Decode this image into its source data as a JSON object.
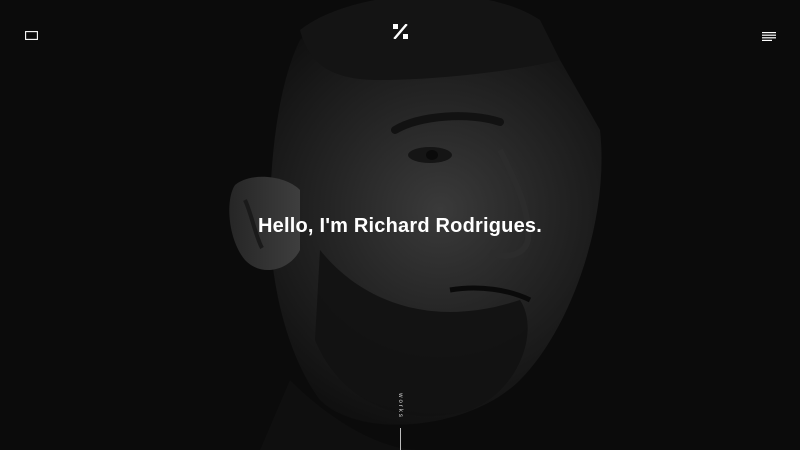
{
  "header": {
    "left_icon": "window-outline-icon",
    "logo_icon": "percent-logo-icon",
    "menu_icon": "hamburger-menu-icon"
  },
  "hero": {
    "title": "Hello, I'm Richard Rodrigues.",
    "background_image": "grayscale-portrait-of-bearded-man"
  },
  "scroll_cue": {
    "label": "works"
  },
  "colors": {
    "background": "#0b0b0b",
    "text": "#ffffff",
    "line": "#bdbdbd"
  }
}
